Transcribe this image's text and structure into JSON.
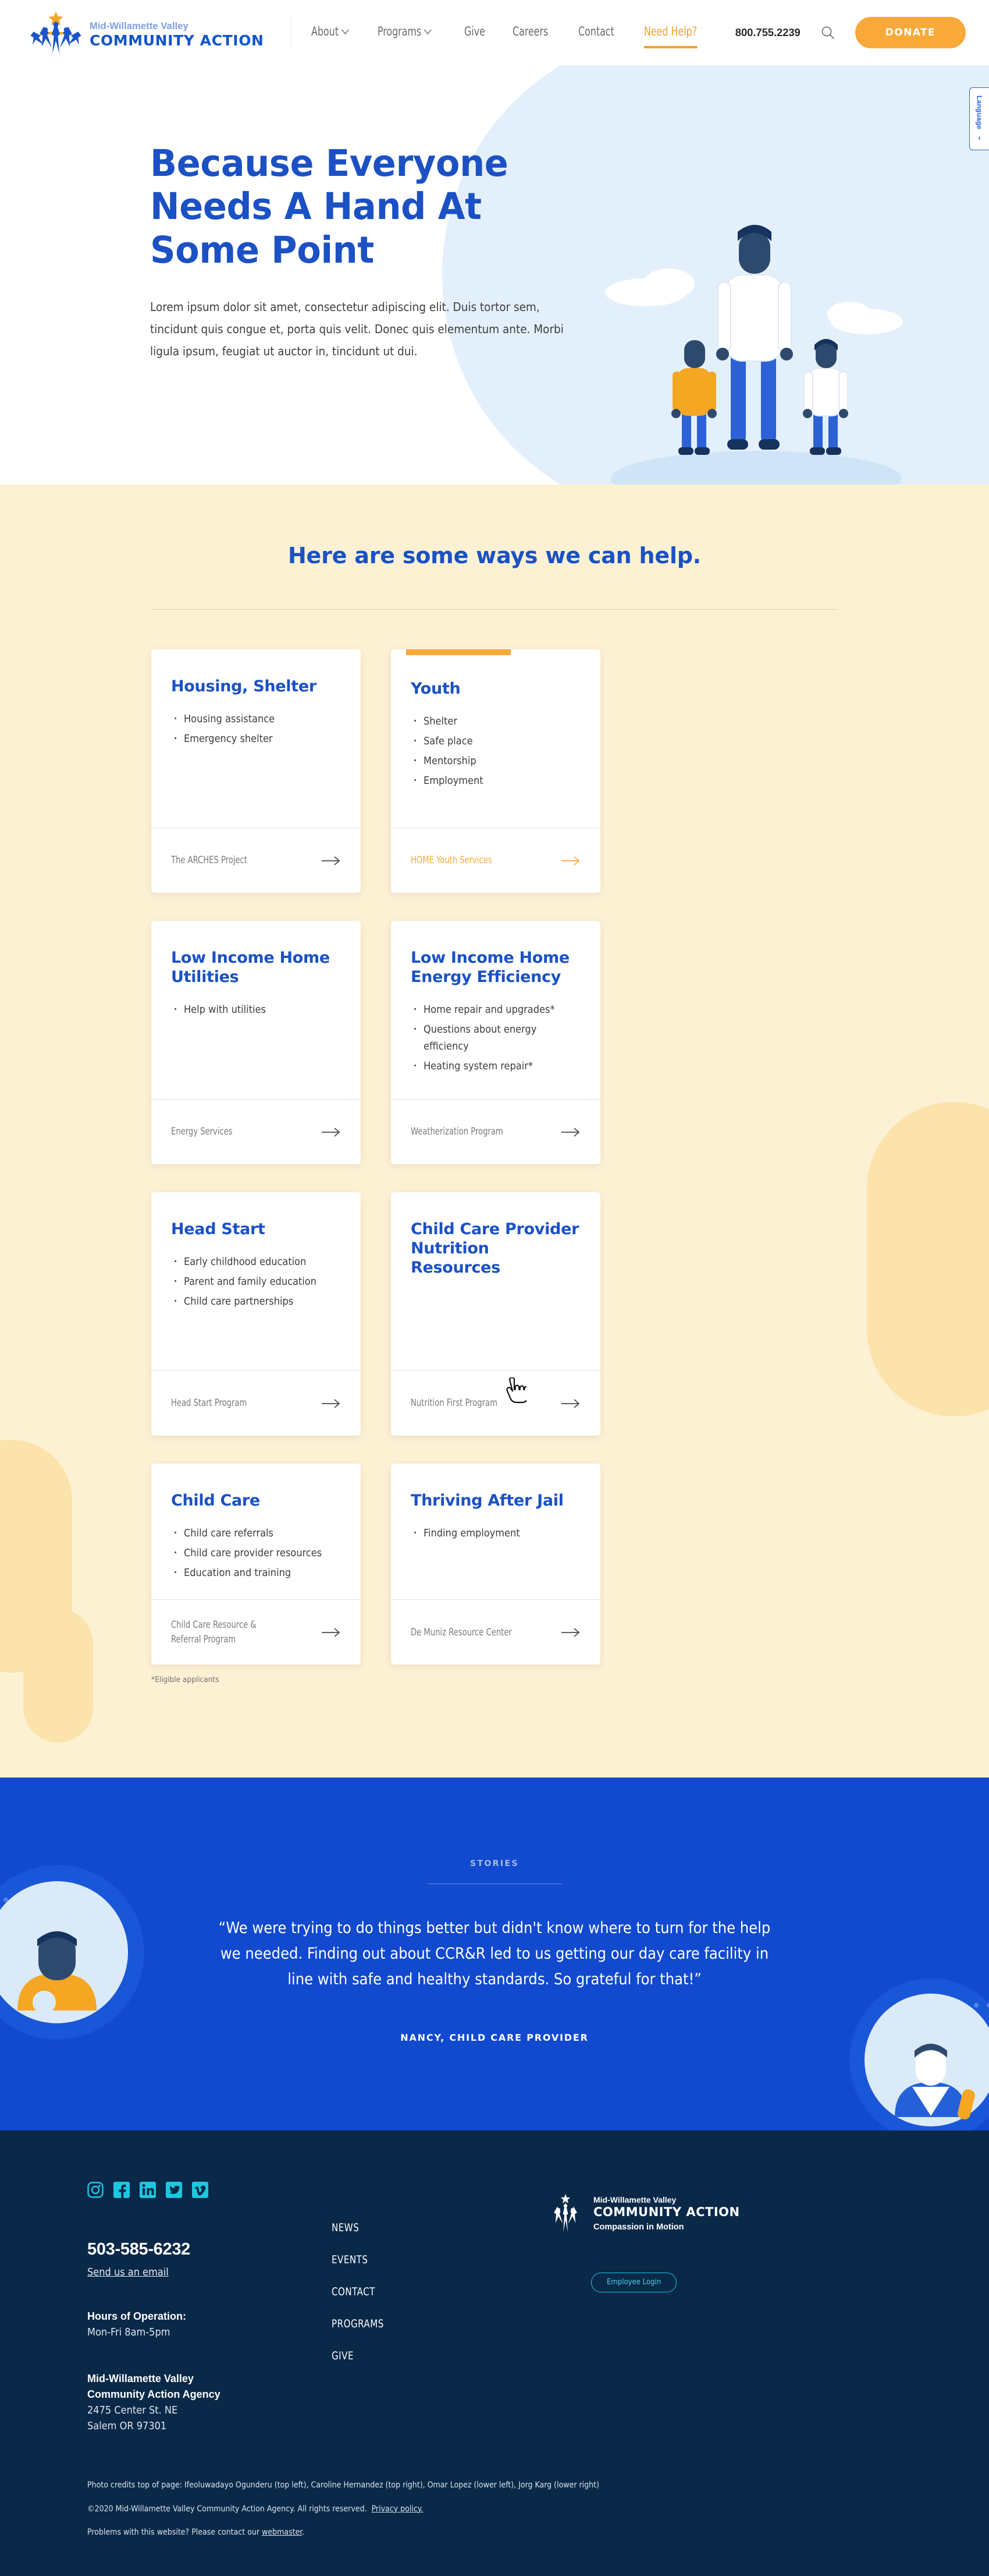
{
  "header": {
    "logo": {
      "sub": "Mid-Willamette Valley",
      "main": "COMMUNITY ACTION"
    },
    "nav": [
      {
        "label": "About",
        "has_caret": true,
        "active": false
      },
      {
        "label": "Programs",
        "has_caret": true,
        "active": false
      },
      {
        "label": "Give",
        "has_caret": false,
        "active": false
      },
      {
        "label": "Careers",
        "has_caret": false,
        "active": false
      },
      {
        "label": "Contact",
        "has_caret": false,
        "active": false
      },
      {
        "label": "Need Help?",
        "has_caret": false,
        "active": true
      }
    ],
    "phone": "800.755.2239",
    "search_icon": "search-icon",
    "donate_label": "DONATE"
  },
  "language_widget": {
    "label": "Language",
    "arrow": "‹"
  },
  "hero": {
    "title": "Because Everyone Needs A Hand At Some Point",
    "paragraph": "Lorem ipsum dolor sit amet, consectetur adipiscing elit. Duis tortor sem, tincidunt quis congue et, porta quis velit. Donec quis elementum ante. Morbi ligula ipsum, feugiat ut auctor in, tincidunt ut dui."
  },
  "ways": {
    "heading": "Here are some ways we can help.",
    "footnote": "*Eligible applicants",
    "cards": [
      {
        "title": "Housing, Shelter",
        "items": [
          "Housing assistance",
          "Emergency shelter"
        ],
        "link": "The ARCHES Project",
        "hovered": false
      },
      {
        "title": "Youth",
        "items": [
          "Shelter",
          "Safe place",
          "Mentorship",
          "Employment"
        ],
        "link": "HOME Youth Services",
        "hovered": true
      },
      {
        "title": "Low Income Home Utilities",
        "items": [
          "Help with utilities"
        ],
        "link": "Energy Services",
        "hovered": false
      },
      {
        "title": "Low Income Home Energy Efficiency",
        "items": [
          "Home repair and upgrades*",
          "Questions about energy efficiency",
          "Heating system repair*"
        ],
        "link": "Weatherization Program",
        "hovered": false
      },
      {
        "title": "Head Start",
        "items": [
          "Early childhood education",
          "Parent and family education",
          "Child care partnerships"
        ],
        "link": "Head Start Program",
        "hovered": false
      },
      {
        "title": "Child Care Provider Nutrition Resources",
        "items": [],
        "link": "Nutrition First Program",
        "hovered": false
      },
      {
        "title": "Child Care",
        "items": [
          "Child care referrals",
          "Child care provider resources",
          "Education and training"
        ],
        "link": "Child Care Resource &\nReferral Program",
        "hovered": false
      },
      {
        "title": "Thriving After Jail",
        "items": [
          "Finding employment"
        ],
        "link": "De Muniz Resource Center",
        "hovered": false
      }
    ]
  },
  "stories": {
    "eyebrow": "STORIES",
    "quote": "“We were trying to do things better but didn't know where to turn for the help we needed. Finding out about CCR&R led to us getting our day care facility in line with safe and healthy standards. So grateful for that!”",
    "attribution": "NANCY, CHILD CARE PROVIDER"
  },
  "footer": {
    "social": [
      "instagram-icon",
      "facebook-icon",
      "linkedin-icon",
      "twitter-icon",
      "vimeo-icon"
    ],
    "phone": "503-585-6232",
    "email_link": "Send us an email",
    "hours_label": "Hours of Operation:",
    "hours_value": "Mon-Fri  8am-5pm",
    "org_name_line1": "Mid-Willamette Valley",
    "org_name_line2": "Community Action Agency",
    "address_line1": "2475 Center St. NE",
    "address_line2": "Salem OR 97301",
    "nav": [
      "NEWS",
      "EVENTS",
      "CONTACT",
      "PROGRAMS",
      "GIVE"
    ],
    "logo": {
      "sub": "Mid-Willamette Valley",
      "main": "COMMUNITY ACTION",
      "tagline": "Compassion in Motion"
    },
    "employee_login": "Employee Login",
    "legal": {
      "credits": "Photo credits top of page: Ifeoluwadayo Ogunderu (top left), Caroline Hernandez (top right), Omar Lopez (lower left), Jorg Karg (lower right)",
      "copyright": "©2020 Mid-Willamette Valley Community Action Agency. All rights reserved.",
      "privacy_link": "Privacy policy.",
      "problems_prefix": "Problems with this website? Please contact our ",
      "webmaster_link": "webmaster",
      "problems_suffix": "."
    }
  },
  "colors": {
    "brand_blue": "#1b51c4",
    "accent_orange": "#f9a93a",
    "cream": "#fdf1d4",
    "stories_blue": "#1149cf",
    "footer_navy": "#0a2949",
    "cyan": "#1dc7e0"
  }
}
